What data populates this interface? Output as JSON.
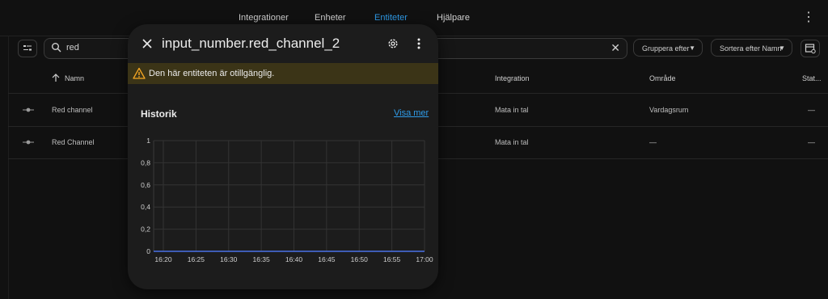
{
  "tabs": [
    {
      "label": "Integrationer",
      "active": false
    },
    {
      "label": "Enheter",
      "active": false
    },
    {
      "label": "Entiteter",
      "active": true
    },
    {
      "label": "Hjälpare",
      "active": false
    }
  ],
  "search": {
    "value": "red"
  },
  "filters": {
    "group_label": "Gruppera efter",
    "sort_label": "Sortera efter Namn"
  },
  "table": {
    "headers": {
      "name": "Namn",
      "integration": "Integration",
      "area": "Område",
      "status": "Stat..."
    },
    "rows": [
      {
        "name": "Red channel",
        "integration": "Mata in tal",
        "area": "Vardagsrum",
        "status": "—"
      },
      {
        "name": "Red Channel",
        "integration": "Mata in tal",
        "area": "—",
        "status": "—"
      }
    ]
  },
  "dialog": {
    "title": "input_number.red_channel_2",
    "warning": "Den här entiteten är otillgänglig.",
    "history_title": "Historik",
    "show_more": "Visa mer"
  },
  "colors": {
    "accent": "#2f9be8",
    "warning": "#f5a623",
    "warning_bg": "#3b3417",
    "series": "#4a72e8"
  },
  "chart_data": {
    "type": "line",
    "x": [
      "16:20",
      "16:25",
      "16:30",
      "16:35",
      "16:40",
      "16:45",
      "16:50",
      "16:55",
      "17:00"
    ],
    "y_ticks": [
      "0",
      "0,2",
      "0,4",
      "0,6",
      "0,8",
      "1"
    ],
    "ylim": [
      0,
      1
    ],
    "series": [
      {
        "values": [
          0,
          0,
          0,
          0,
          0,
          0,
          0,
          0,
          0
        ]
      }
    ],
    "grid": true
  }
}
